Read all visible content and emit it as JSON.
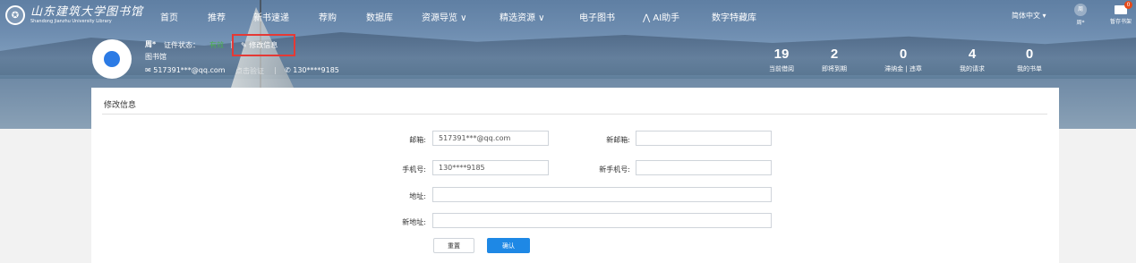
{
  "logo": {
    "cn": "山东建筑大学图书馆",
    "en": "Shandong Jianzhu University Library"
  },
  "nav": {
    "items": [
      "首页",
      "推荐",
      "新书速递",
      "荐购",
      "数据库",
      "资源导览 ∨",
      "精选资源 ∨",
      "电子图书",
      "AI助手",
      "数字特藏库"
    ],
    "ai_prefix": "⋀",
    "language": "简体中文 ▾",
    "user_short": "周*",
    "user_avatar_text": "周",
    "shelf_label": "暂存书架",
    "shelf_badge": "0"
  },
  "profile": {
    "name": "周*",
    "cert_label": "证件状态：",
    "cert_status": "有效",
    "edit_link": "修改信息",
    "org": "图书馆",
    "email": "517391***@qq.com",
    "email_verify": "点击验证",
    "phone": "130****9185"
  },
  "stats": [
    {
      "value": "19",
      "label": "当前借阅"
    },
    {
      "value": "2",
      "label": "即将到期"
    },
    {
      "value": "0",
      "label": "滞纳金 | 违章"
    },
    {
      "value": "4",
      "label": "我的请求"
    },
    {
      "value": "0",
      "label": "我的书单"
    }
  ],
  "form": {
    "title": "修改信息",
    "email_label": "邮箱:",
    "email_value": "517391***@qq.com",
    "new_email_label": "新邮箱:",
    "new_email_value": "",
    "phone_label": "手机号:",
    "phone_value": "130****9185",
    "new_phone_label": "新手机号:",
    "new_phone_value": "",
    "address_label": "地址:",
    "address_value": "",
    "new_address_label": "新地址:",
    "new_address_value": "",
    "reset_label": "重置",
    "confirm_label": "确认"
  },
  "colors": {
    "accent": "#1e88e5",
    "highlight_box": "#e53935",
    "status_valid": "#4caf50"
  }
}
